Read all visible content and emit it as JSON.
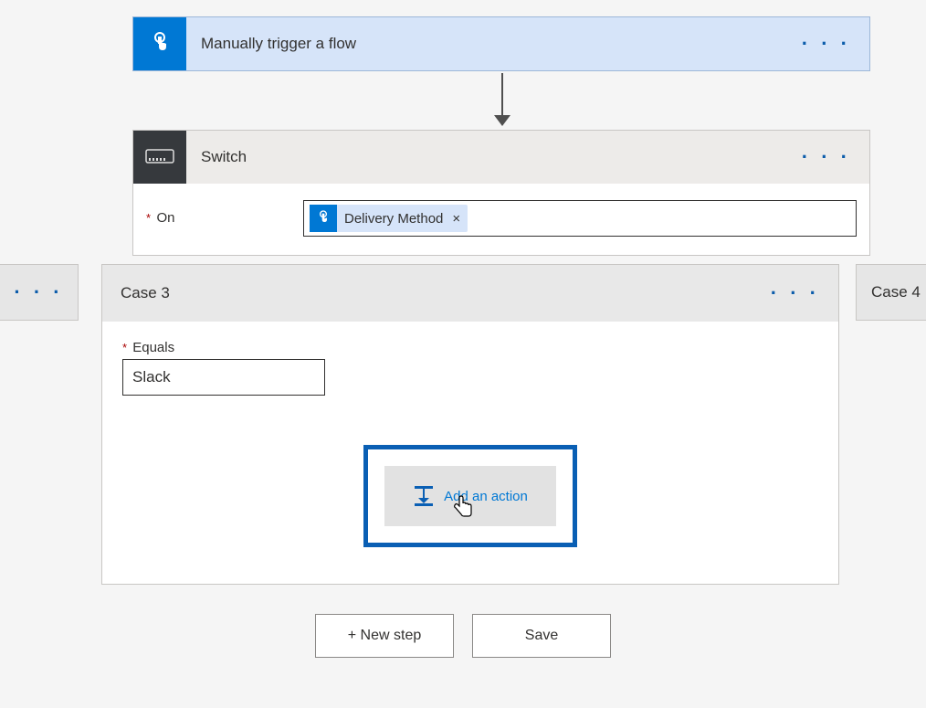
{
  "trigger": {
    "title": "Manually trigger a flow"
  },
  "switch": {
    "title": "Switch",
    "on_label": "On",
    "token": {
      "label": "Delivery Method",
      "remove": "×"
    }
  },
  "case": {
    "title": "Case 3",
    "equals_label": "Equals",
    "equals_value": "Slack",
    "add_action_label": "Add an action"
  },
  "case_prev": "",
  "case_next": "Case 4",
  "buttons": {
    "new_step": "+ New step",
    "save": "Save"
  },
  "ellipsis": "· · ·"
}
